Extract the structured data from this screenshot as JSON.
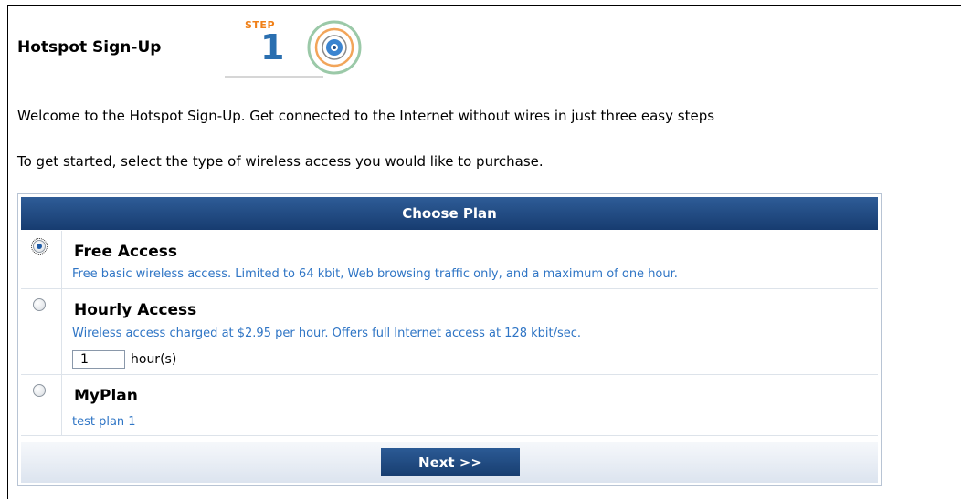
{
  "page": {
    "title": "Hotspot Sign-Up",
    "step_label": "STEP",
    "step_number": "1",
    "intro_line1": "Welcome to the Hotspot Sign-Up. Get connected to the Internet without wires in just three easy steps",
    "intro_line2": "To get started, select the type of wireless access you would like to purchase."
  },
  "plans": {
    "header": "Choose Plan",
    "items": [
      {
        "name": "Free Access",
        "description": "Free basic wireless access. Limited to 64 kbit, Web browsing traffic only, and a maximum of one hour.",
        "selected": true
      },
      {
        "name": "Hourly Access",
        "description": "Wireless access charged at $2.95 per hour. Offers full Internet access at 128 kbit/sec.",
        "hours_value": "1",
        "hours_label": "hour(s)",
        "selected": false
      },
      {
        "name": "MyPlan",
        "description": "test plan 1",
        "selected": false
      }
    ],
    "next_label": "Next >>"
  },
  "colors": {
    "header_blue": "#1f4a84",
    "link_blue": "#2f75c5",
    "step_orange": "#f08018"
  }
}
